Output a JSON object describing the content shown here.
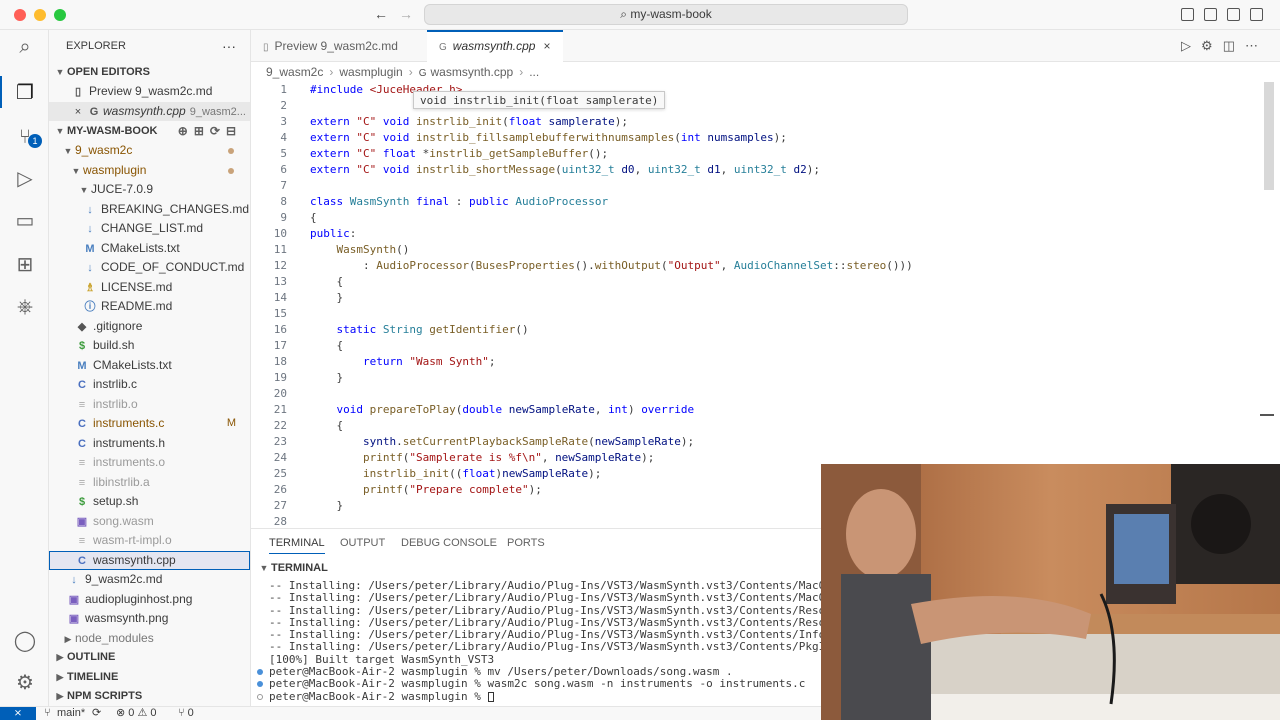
{
  "window": {
    "search_text": "my-wasm-book",
    "back_icon": "arrow-left",
    "forward_icon": "arrow-right"
  },
  "activity": {
    "source_control_badge": "1"
  },
  "sidebar": {
    "title": "EXPLORER",
    "more_label": "···",
    "open_editors": {
      "label": "OPEN EDITORS",
      "items": [
        {
          "label": "Preview 9_wasm2c.md",
          "detail": ""
        },
        {
          "label": "wasmsynth.cpp",
          "detail": "9_wasm2..."
        }
      ]
    },
    "project": {
      "label": "MY-WASM-BOOK",
      "folders": {
        "wasm2c": "9_wasm2c",
        "wasmplugin": "wasmplugin",
        "juce": "JUCE-7.0.9"
      },
      "juce_files": [
        {
          "label": "BREAKING_CHANGES.md",
          "icon": "↓"
        },
        {
          "label": "CHANGE_LIST.md",
          "icon": "↓"
        },
        {
          "label": "CMakeLists.txt",
          "icon": "M"
        },
        {
          "label": "CODE_OF_CONDUCT.md",
          "icon": "↓"
        },
        {
          "label": "LICENSE.md",
          "icon": "♗"
        },
        {
          "label": "README.md",
          "icon": "ⓘ"
        }
      ],
      "plugin_files": [
        {
          "label": ".gitignore",
          "icon": "◆",
          "state": "normal"
        },
        {
          "label": "build.sh",
          "icon": "$",
          "state": "normal"
        },
        {
          "label": "CMakeLists.txt",
          "icon": "M",
          "state": "normal"
        },
        {
          "label": "instrlib.c",
          "icon": "C",
          "state": "normal"
        },
        {
          "label": "instrlib.o",
          "icon": "≡",
          "state": "dim"
        },
        {
          "label": "instruments.c",
          "icon": "C",
          "state": "modified",
          "mark": "M"
        },
        {
          "label": "instruments.h",
          "icon": "C",
          "state": "normal"
        },
        {
          "label": "instruments.o",
          "icon": "≡",
          "state": "dim"
        },
        {
          "label": "libinstrlib.a",
          "icon": "≡",
          "state": "dim"
        },
        {
          "label": "setup.sh",
          "icon": "$",
          "state": "normal"
        },
        {
          "label": "song.wasm",
          "icon": "▣",
          "state": "dim"
        },
        {
          "label": "wasm-rt-impl.o",
          "icon": "≡",
          "state": "dim"
        },
        {
          "label": "wasmsynth.cpp",
          "icon": "C",
          "state": "selected"
        }
      ],
      "wasm2c_files": [
        {
          "label": "9_wasm2c.md",
          "icon": "↓"
        },
        {
          "label": "audiopluginhost.png",
          "icon": "▣"
        },
        {
          "label": "wasmsynth.png",
          "icon": "▣"
        }
      ],
      "node_modules": "node_modules"
    },
    "bottom_sections": [
      "OUTLINE",
      "TIMELINE",
      "NPM SCRIPTS"
    ]
  },
  "tabs": [
    {
      "label": "Preview 9_wasm2c.md",
      "active": false
    },
    {
      "label": "wasmsynth.cpp",
      "active": true,
      "close": "×"
    }
  ],
  "breadcrumb": [
    "9_wasm2c",
    "wasmplugin",
    "wasmsynth.cpp",
    "..."
  ],
  "hover_tooltip": "void instrlib_init(float samplerate)",
  "code_lines": [
    {
      "n": "1",
      "text": "#include <JuceHeader.h>"
    },
    {
      "n": "2",
      "text": ""
    },
    {
      "n": "3",
      "text": "extern \"C\" void instrlib_init(float samplerate);"
    },
    {
      "n": "4",
      "text": "extern \"C\" void instrlib_fillsamplebufferwithnumsamples(int numsamples);"
    },
    {
      "n": "5",
      "text": "extern \"C\" float *instrlib_getSampleBuffer();"
    },
    {
      "n": "6",
      "text": "extern \"C\" void instrlib_shortMessage(uint32_t d0, uint32_t d1, uint32_t d2);"
    },
    {
      "n": "7",
      "text": ""
    },
    {
      "n": "8",
      "text": "class WasmSynth final : public AudioProcessor"
    },
    {
      "n": "9",
      "text": "{"
    },
    {
      "n": "10",
      "text": "public:"
    },
    {
      "n": "11",
      "text": "    WasmSynth()"
    },
    {
      "n": "12",
      "text": "        : AudioProcessor(BusesProperties().withOutput(\"Output\", AudioChannelSet::stereo()))"
    },
    {
      "n": "13",
      "text": "    {"
    },
    {
      "n": "14",
      "text": "    }"
    },
    {
      "n": "15",
      "text": ""
    },
    {
      "n": "16",
      "text": "    static String getIdentifier()"
    },
    {
      "n": "17",
      "text": "    {"
    },
    {
      "n": "18",
      "text": "        return \"Wasm Synth\";"
    },
    {
      "n": "19",
      "text": "    }"
    },
    {
      "n": "20",
      "text": ""
    },
    {
      "n": "21",
      "text": "    void prepareToPlay(double newSampleRate, int) override"
    },
    {
      "n": "22",
      "text": "    {"
    },
    {
      "n": "23",
      "text": "        synth.setCurrentPlaybackSampleRate(newSampleRate);"
    },
    {
      "n": "24",
      "text": "        printf(\"Samplerate is %f\\n\", newSampleRate);"
    },
    {
      "n": "25",
      "text": "        instrlib_init((float)newSampleRate);"
    },
    {
      "n": "26",
      "text": "        printf(\"Prepare complete\");"
    },
    {
      "n": "27",
      "text": "    }"
    },
    {
      "n": "28",
      "text": ""
    }
  ],
  "panel": {
    "tabs": [
      "TERMINAL",
      "OUTPUT",
      "DEBUG CONSOLE",
      "PORTS"
    ],
    "terminal_title": "TERMINAL",
    "lines": [
      {
        "text": "-- Installing: /Users/peter/Library/Audio/Plug-Ins/VST3/WasmSynth.vst3/Contents/MacOS",
        "prompt": "none"
      },
      {
        "text": "-- Installing: /Users/peter/Library/Audio/Plug-Ins/VST3/WasmSynth.vst3/Contents/MacOS/Was",
        "prompt": "none"
      },
      {
        "text": "-- Installing: /Users/peter/Library/Audio/Plug-Ins/VST3/WasmSynth.vst3/Contents/Resources",
        "prompt": "none"
      },
      {
        "text": "-- Installing: /Users/peter/Library/Audio/Plug-Ins/VST3/WasmSynth.vst3/Contents/Resources",
        "prompt": "none"
      },
      {
        "text": "-- Installing: /Users/peter/Library/Audio/Plug-Ins/VST3/WasmSynth.vst3/Contents/Info.plis",
        "prompt": "none"
      },
      {
        "text": "-- Installing: /Users/peter/Library/Audio/Plug-Ins/VST3/WasmSynth.vst3/Contents/PkgInfo",
        "prompt": "none"
      },
      {
        "text": "[100%] Built target WasmSynth_VST3",
        "prompt": "none"
      },
      {
        "text": "peter@MacBook-Air-2 wasmplugin % mv /Users/peter/Downloads/song.wasm .",
        "prompt": "filled"
      },
      {
        "text": "peter@MacBook-Air-2 wasmplugin % wasm2c song.wasm -n instruments -o instruments.c",
        "prompt": "filled"
      },
      {
        "text": "peter@MacBook-Air-2 wasmplugin % ",
        "prompt": "hollow"
      }
    ]
  },
  "status": {
    "remote": "⨯",
    "branch": "main*",
    "sync": "⟳",
    "problems": "⊗ 0 ⚠ 0",
    "ports": "⑂ 0"
  },
  "colors": {
    "accent": "#005fb8",
    "keyword": "#0000ff",
    "type": "#267f99",
    "string": "#a31515",
    "function": "#795e26",
    "modified": "#895503"
  }
}
